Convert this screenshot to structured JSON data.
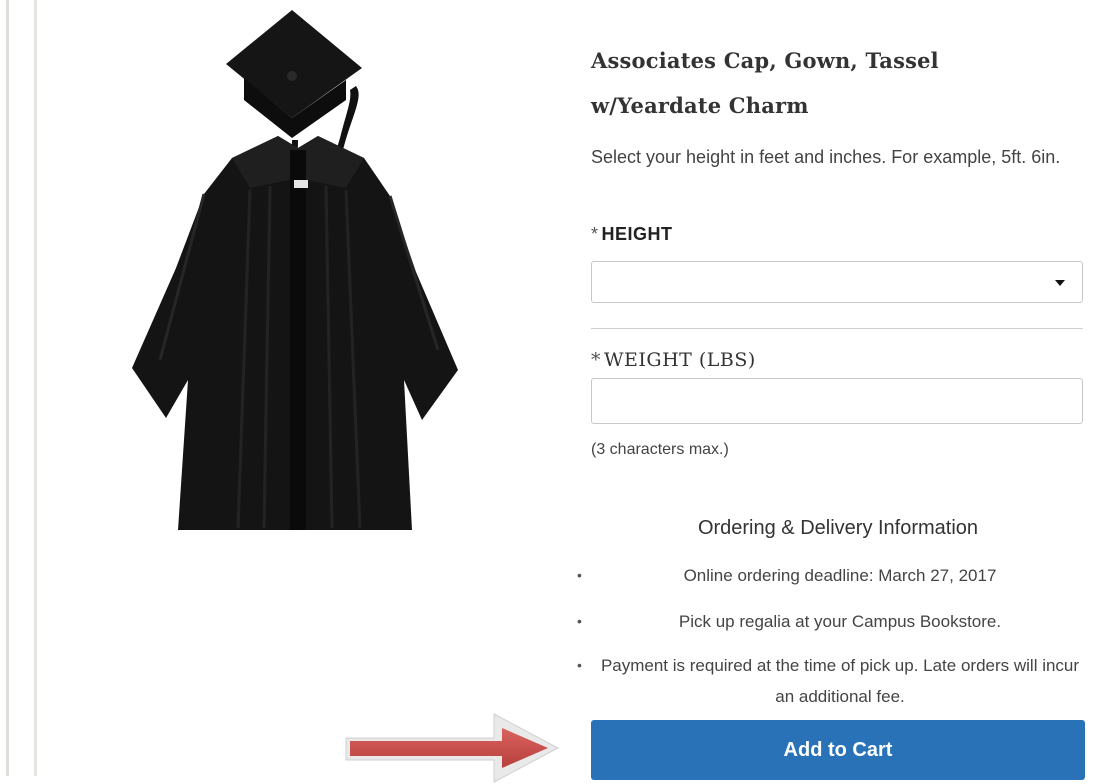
{
  "product": {
    "title_line1": "Associates Cap, Gown, Tassel",
    "title_line2": "w/Yeardate Charm",
    "instructions": "Select your height in feet and inches. For example, 5ft. 6in.",
    "image_icon": "graduation-gown-icon"
  },
  "form": {
    "height": {
      "required_marker": "*",
      "label": "HEIGHT",
      "selected_value": ""
    },
    "weight": {
      "required_marker": "*",
      "label": "WEIGHT (LBS)",
      "value": "",
      "note": "(3 characters max.)"
    }
  },
  "ordering_info": {
    "heading": "Ordering & Delivery Information",
    "bullet_glyph": "•",
    "items": [
      "Online ordering deadline: March 27, 2017",
      "Pick up regalia at your Campus Bookstore.",
      "Payment is required at the time of pick up. Late orders will incur an additional fee."
    ]
  },
  "cart": {
    "add_label": "Add to Cart"
  },
  "colors": {
    "button_blue": "#2a72b8",
    "arrow_red": "#c0504d"
  }
}
